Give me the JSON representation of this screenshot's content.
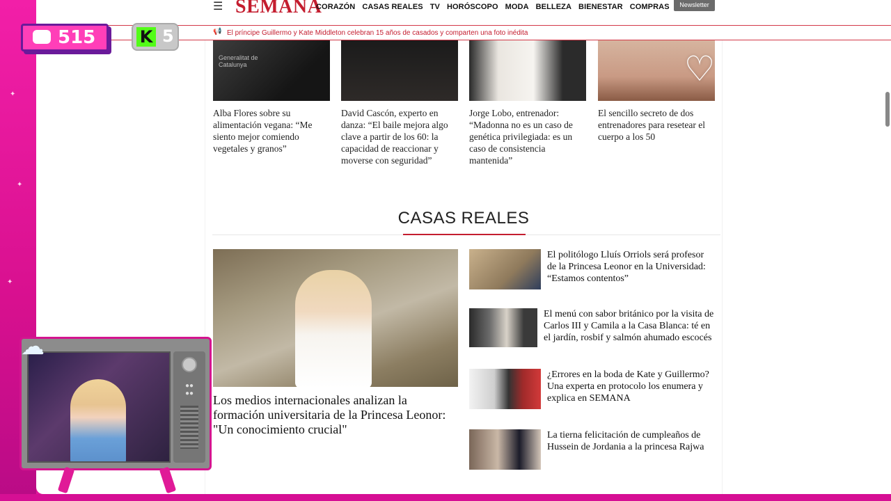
{
  "header": {
    "logo": "SEMANA",
    "nav": [
      "CORAZÓN",
      "CASAS REALES",
      "TV",
      "HORÓSCOPO",
      "MODA",
      "BELLEZA",
      "BIENESTAR",
      "COMPRAS"
    ],
    "newsletter_label": "Newsletter",
    "ticker_text": "El príncipe Guillermo y Kate Middleton celebran 15 años de casados y comparten una foto inédita"
  },
  "top_articles": [
    {
      "title": "Alba Flores sobre su alimentación vegana: “Me siento mejor comiendo vegetales y granos”",
      "image_caption": "Generalitat de Catalunya"
    },
    {
      "title": "David Cascón, experto en danza: “El baile mejora algo clave a partir de los 60: la capacidad de reaccionar y moverse con seguridad”"
    },
    {
      "title": "Jorge Lobo, entrenador: “Madonna no es un caso de genética privilegiada: es un caso de consistencia mantenida”"
    },
    {
      "title": "El sencillo secreto de dos entrenadores para resetear el cuerpo a los 50"
    }
  ],
  "section": {
    "title": "CASAS REALES",
    "lead_title": "Los medios internacionales analizan la formación universitaria de la Princesa Leonor: \"Un conocimiento crucial\"",
    "side_items": [
      "El politólogo Lluís Orriols será profesor de la Princesa Leonor en la Universidad: “Estamos contentos”",
      "El menú con sabor británico por la visita de Carlos III y Camila a la Casa Blanca: té en el jardín, rosbif y salmón ahumado escocés",
      "¿Errores en la boda de Kate y Guillermo? Una experta en protocolo los enumera y explica en SEMANA",
      "La tierna felicitación de cumpleaños de Hussein de Jordania a la princesa Rajwa"
    ]
  },
  "overlay": {
    "chat_count": "515",
    "k_letter": "K",
    "k_count": "5",
    "watermark_icon": "heart-play-icon"
  },
  "colors": {
    "brand_red": "#c41d2f",
    "stream_pink": "#e0179a",
    "kick_green": "#53fc18"
  }
}
